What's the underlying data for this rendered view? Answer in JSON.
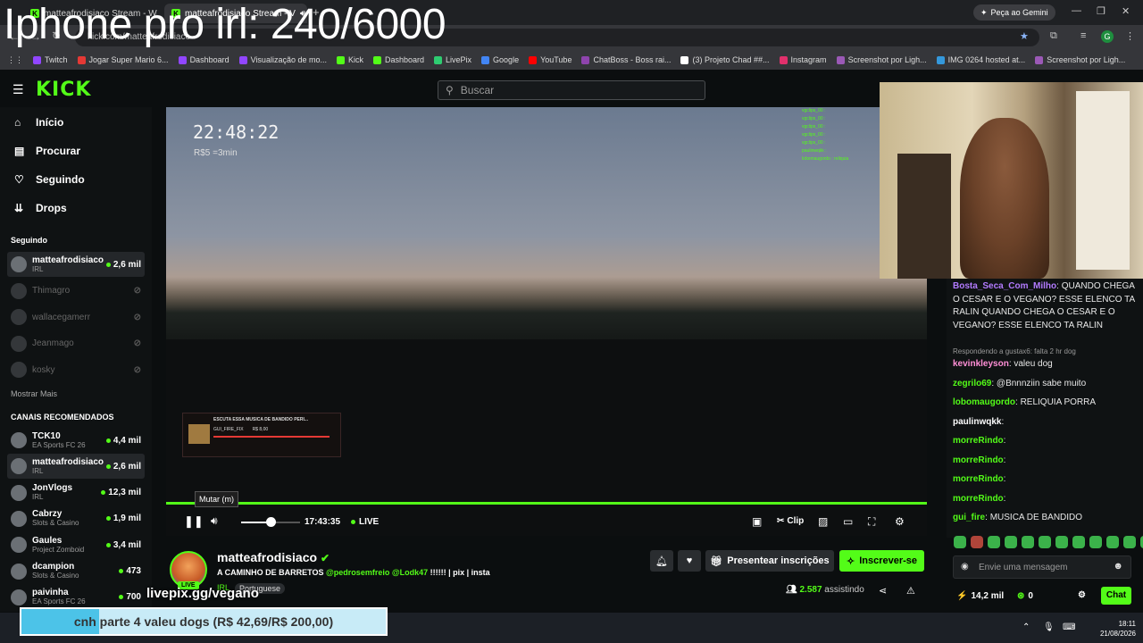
{
  "overlay_title": "Iphone pro irl: 240/6000",
  "browser": {
    "tabs": [
      {
        "label": "matteafrodisiaco Stream - Wat"
      },
      {
        "label": "matteafrodisiaco Stream - V"
      }
    ],
    "gemini_button": "Peça ao Gemini",
    "address": "kick.com/matteafrodisiaco",
    "bookmarks": [
      {
        "label": "Twitch",
        "color": "#9146ff"
      },
      {
        "label": "Jogar Super Mario 6...",
        "color": "#e53935"
      },
      {
        "label": "Dashboard",
        "color": "#9146ff"
      },
      {
        "label": "Visualização de mo...",
        "color": "#9146ff"
      },
      {
        "label": "Kick",
        "color": "#53fc18"
      },
      {
        "label": "Dashboard",
        "color": "#53fc18"
      },
      {
        "label": "LivePix",
        "color": "#2ecc71"
      },
      {
        "label": "Google",
        "color": "#4285f4"
      },
      {
        "label": "YouTube",
        "color": "#ff0000"
      },
      {
        "label": "ChatBoss - Boss rai...",
        "color": "#8e44ad"
      },
      {
        "label": "(3) Projeto Chad ##...",
        "color": "#ffffff"
      },
      {
        "label": "Instagram",
        "color": "#e1306c"
      },
      {
        "label": "Screenshot por Ligh...",
        "color": "#9b59b6"
      },
      {
        "label": "IMG 0264 hosted at...",
        "color": "#3498db"
      },
      {
        "label": "Screenshot por Ligh...",
        "color": "#9b59b6"
      }
    ]
  },
  "site": {
    "logo": "KICK",
    "search_placeholder": "Buscar"
  },
  "nav": [
    {
      "label": "Início",
      "icon": "home-icon",
      "glyph": "⌂"
    },
    {
      "label": "Procurar",
      "icon": "browse-icon",
      "glyph": "▤"
    },
    {
      "label": "Seguindo",
      "icon": "heart-icon",
      "glyph": "♡"
    },
    {
      "label": "Drops",
      "icon": "drops-icon",
      "glyph": "⇊"
    }
  ],
  "following": {
    "title": "Seguindo",
    "channels": [
      {
        "name": "matteafrodisiaco",
        "category": "IRL",
        "viewers": "2,6 mil",
        "live": true
      },
      {
        "name": "Thimagro",
        "category": "",
        "viewers": "",
        "live": false
      },
      {
        "name": "wallacegamerr",
        "category": "",
        "viewers": "",
        "live": false
      },
      {
        "name": "Jeanmago",
        "category": "",
        "viewers": "",
        "live": false
      },
      {
        "name": "kosky",
        "category": "",
        "viewers": "",
        "live": false
      }
    ],
    "show_more": "Mostrar Mais"
  },
  "recommended": {
    "title": "CANAIS RECOMENDADOS",
    "channels": [
      {
        "name": "TCK10",
        "category": "EA Sports FC 26",
        "viewers": "4,4 mil"
      },
      {
        "name": "matteafrodisiaco",
        "category": "IRL",
        "viewers": "2,6 mil"
      },
      {
        "name": "JonVlogs",
        "category": "IRL",
        "viewers": "12,3 mil"
      },
      {
        "name": "Cabrzy",
        "category": "Slots & Casino",
        "viewers": "1,9 mil"
      },
      {
        "name": "Gaules",
        "category": "Project Zomboid",
        "viewers": "3,4 mil"
      },
      {
        "name": "dcampion",
        "category": "Slots & Casino",
        "viewers": "473"
      },
      {
        "name": "paivinha",
        "category": "EA Sports FC 26",
        "viewers": "700"
      }
    ]
  },
  "video": {
    "clock": "22:48:22",
    "rate": "R$5 =3min",
    "minichat": [
      "vgclips_00 :",
      "vgclips_00 :",
      "vgclips_00 :",
      "vgclips_00 :",
      "vgclips_00 :",
      "paulinwqkk :",
      "lobomaugordo : reliquia"
    ],
    "music_title": "ESCUTA ESSA MUSICA DE BANDIDO PERI...",
    "music_user": "GUI_FIRE_FIX",
    "music_amount": "R$ 8,00",
    "tooltip": "Mutar (m)",
    "time": "17:43:35",
    "live_label": "LIVE",
    "clip_label": "Clip",
    "volume_level": 0.5,
    "progress": 1.0
  },
  "stream": {
    "name": "matteafrodisiaco",
    "title": "A CAMINHO DE BARRETOS",
    "title_mentions": "@pedrosemfreio @Lodk47",
    "title_tail": "!!!!!! | pix | insta",
    "category": "IRL",
    "language": "Portuguese",
    "live_badge": "LIVE",
    "viewers": "2.587",
    "viewers_label": "assistindo",
    "gift_button": "Presentear inscrições",
    "subscribe_button": "Inscrever-se"
  },
  "chat": {
    "messages": [
      {
        "user": "Bosta_Seca_Com_Milho",
        "color": "#b37bff",
        "text": "QUANDO CHEGA O CESAR E O VEGANO? ESSE ELENCO TA RALIN QUANDO CHEGA O CESAR E O VEGANO? ESSE ELENCO TA RALIN"
      },
      {
        "user": "",
        "color": "#999999",
        "text": "Respondendo a gustax6: falta 2 hr dog"
      },
      {
        "user": "kevinkleyson",
        "color": "#ff8fd6",
        "text": "valeu dog"
      },
      {
        "user": "zegrilo69",
        "color": "#53fc18",
        "text": "@Bnnnziin sabe muito"
      },
      {
        "user": "lobomaugordo",
        "color": "#53fc18",
        "text": "RELIQUIA PORRA"
      },
      {
        "user": "paulinwqkk",
        "color": "#ffffff",
        "text": ""
      },
      {
        "user": "morreRindo",
        "color": "#53fc18",
        "text": ""
      },
      {
        "user": "morreRindo",
        "color": "#53fc18",
        "text": ""
      },
      {
        "user": "morreRindo",
        "color": "#53fc18",
        "text": ""
      },
      {
        "user": "morreRindo",
        "color": "#53fc18",
        "text": ""
      },
      {
        "user": "gui_fire",
        "color": "#53fc18",
        "text": "MUSICA DE BANDIDO"
      }
    ],
    "input_placeholder": "Envie uma mensagem",
    "points": "14,2 mil",
    "kicks": "0",
    "send_button": "Chat"
  },
  "overlays": {
    "livepix": "livepix.gg/vegano",
    "donation_text": "cnh parte 4 valeu dogs (R$ 42,69/R$ 200,00)",
    "donation_progress": 0.2135
  },
  "taskbar": {
    "time": "18:11",
    "date": "21/08/2026"
  }
}
